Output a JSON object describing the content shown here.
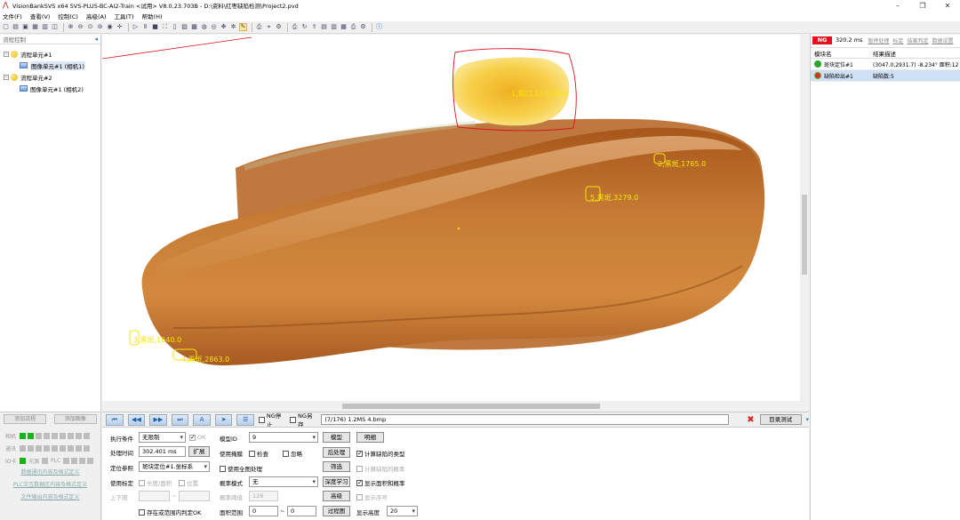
{
  "window": {
    "title": "VisionBankSVS x64 SVS-PLUS-BC-AI2-Train  <试用>  V8.0.23.703B - D:\\资料\\红枣缺陷检测\\Project2.pvd",
    "minimize": "–",
    "maximize": "❐",
    "close": "✕"
  },
  "menu": [
    "文件(F)",
    "查看(V)",
    "控制(C)",
    "高级(A)",
    "工具(T)",
    "帮助(H)"
  ],
  "left_panel": {
    "header": "流程控制",
    "pin": "◂",
    "tree": [
      {
        "label": "流程单元#1",
        "expand": "–",
        "child": "图像单元#1 (相机1)"
      },
      {
        "label": "流程单元#2",
        "expand": "–",
        "child": "图像单元#1 (相机2)"
      }
    ],
    "add_flow": "添加流程",
    "add_image": "添加图像",
    "status": {
      "camera": "相机",
      "comm": "通讯",
      "io": "IO卡",
      "light": "光源",
      "plc": "PLC"
    },
    "links": [
      "数据通讯内容及格式定义",
      "PLC交互数据区内容及格式定义",
      "文件输出内容及格式定义"
    ]
  },
  "image_view": {
    "labels": [
      {
        "text": "1,裂口,117702.0"
      },
      {
        "text": "2,黑斑,1765.0"
      },
      {
        "text": "5,黑斑,3279.0"
      },
      {
        "text": "3,黑斑,1640.0"
      },
      {
        "text": "4,黑斑,2863.0"
      }
    ]
  },
  "nav": {
    "ng_stop": "NG停止",
    "ng_save": "NG另存",
    "path": "(7/176) 1.2MS 4.bmp",
    "catalog_test": "目录测试"
  },
  "params": {
    "exec_cond_label": "执行条件",
    "exec_cond_value": "无限制",
    "ok_label": "OK",
    "proc_time_label": "处理时间",
    "proc_time_value": "302.401 ms",
    "expand_btn": "扩展",
    "locate_ref_label": "定位参照",
    "locate_ref_value": "斑块定位#1.坐标系",
    "use_calib_label": "使用标定",
    "len_area_label": "长度/面积",
    "position_label": "位置",
    "limits_label": "上下限",
    "tilde": "~",
    "out_of_range_label": "存在或范围内判定OK",
    "model_id_label": "模型ID",
    "model_id_value": "9",
    "model_btn": "模型",
    "detail_btn": "明细",
    "use_mask_label": "使用掩膜",
    "check_label": "检查",
    "ignore_label": "忽略",
    "postproc_btn": "后处理",
    "calc_type_label": "计算缺陷的类型",
    "use_fullimg_label": "使用全图处理",
    "filter_btn": "筛选",
    "calc_prob_label": "计算缺陷的概率",
    "prob_mode_label": "概率模式",
    "prob_mode_value": "无",
    "deep_learn_btn": "深度学习",
    "show_area_label": "显示面积和概率",
    "prob_thresh_label": "概率阈值",
    "prob_thresh_value": "128",
    "advanced_btn": "高级",
    "show_index_label": "显示序号",
    "area_range_label": "面积范围",
    "area_min": "0",
    "area_max": "0",
    "process_img_btn": "过程图",
    "display_height_label": "显示高度",
    "display_height_value": "20"
  },
  "right_panel": {
    "ng": "NG",
    "time": "320.2 ms",
    "links": [
      "暂停处理",
      "标定",
      "结果判定",
      "数据设置"
    ],
    "col_module": "模块名",
    "col_result": "结果描述",
    "rows": [
      {
        "module": "斑块定位#1",
        "result": "(3047.0,2931.7) -8.234° 面积:12",
        "status": "ok"
      },
      {
        "module": "缺陷检出#1",
        "result": "缺陷数:5",
        "status": "ng"
      }
    ]
  },
  "colors": {
    "label": "#f5e60a",
    "ng_red": "#e8101a",
    "defect_box": "#d8141e",
    "status_green": "#14b514"
  }
}
